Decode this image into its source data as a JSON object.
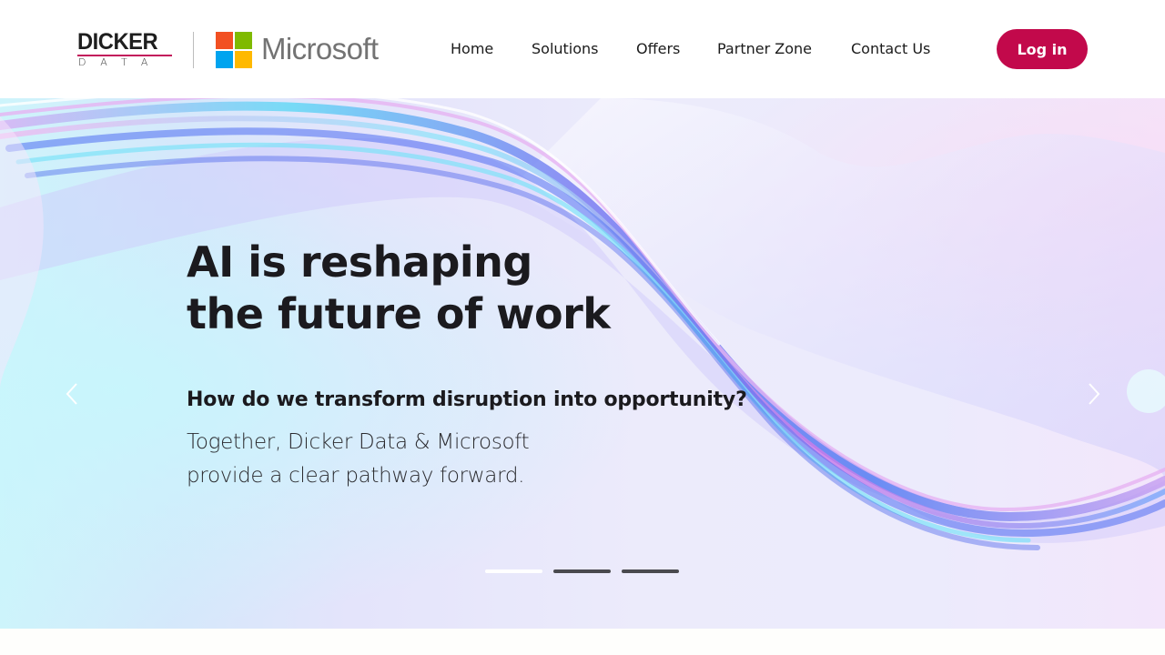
{
  "header": {
    "brand": {
      "dicker_word": "DICKER",
      "dicker_sub": "DATA",
      "partner_word": "Microsoft",
      "icons": [
        "dicker-data-logo",
        "microsoft-logo"
      ]
    },
    "nav": [
      {
        "label": "Home"
      },
      {
        "label": "Solutions"
      },
      {
        "label": "Offers"
      },
      {
        "label": "Partner Zone"
      },
      {
        "label": "Contact Us"
      }
    ],
    "login_label": "Log in"
  },
  "hero": {
    "title_lines": [
      "AI is reshaping",
      "the future of work"
    ],
    "question": "How do we transform disruption into opportunity?",
    "body_lines": [
      "Together, Dicker Data & Microsoft",
      "provide a clear pathway forward."
    ],
    "prev_icon": "chevron-left-icon",
    "next_icon": "chevron-right-icon",
    "carousel": {
      "slides": 3,
      "active_index": 0
    }
  },
  "colors": {
    "accent": "#c2094b",
    "ms_red": "#f25022",
    "ms_green": "#7fba00",
    "ms_blue": "#00a4ef",
    "ms_yellow": "#ffb900",
    "text_dark": "#1b1a1e"
  }
}
